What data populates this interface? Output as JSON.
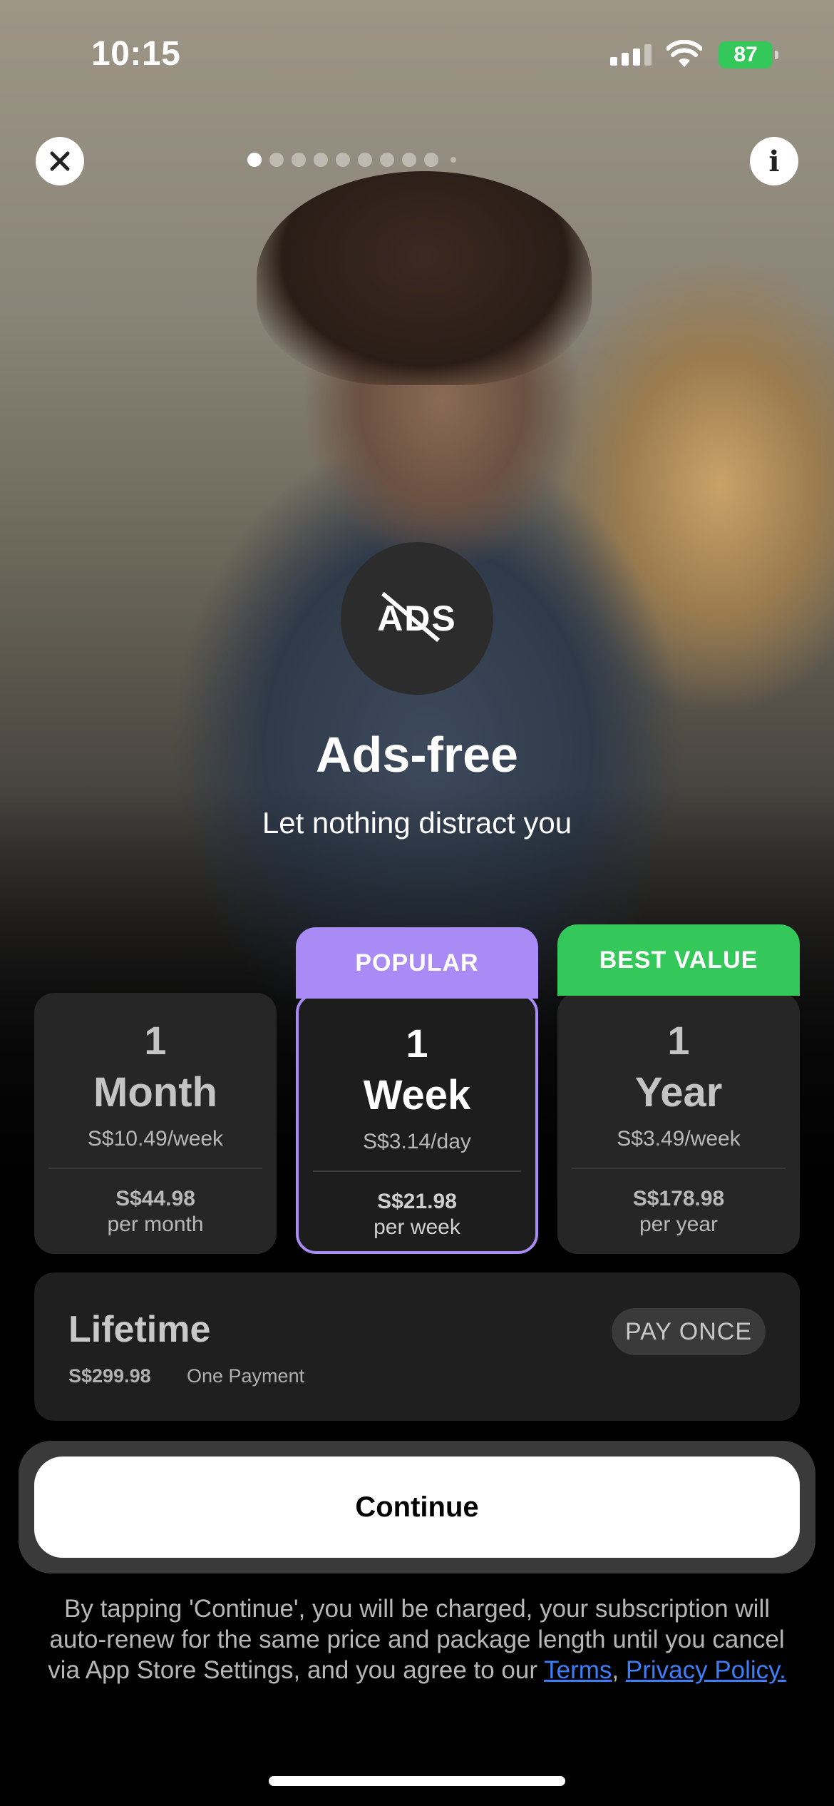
{
  "status_bar": {
    "time": "10:15",
    "battery": "87"
  },
  "pager": {
    "total": 10,
    "active": 0
  },
  "feature": {
    "icon_label": "ADS",
    "title": "Ads-free",
    "subtitle": "Let nothing distract you"
  },
  "plans": [
    {
      "num": "1",
      "unit": "Month",
      "rate": "S$10.49/week",
      "price": "S$44.98",
      "per": "per month"
    },
    {
      "tag": "POPULAR",
      "num": "1",
      "unit": "Week",
      "rate": "S$3.14/day",
      "price": "S$21.98",
      "per": "per week",
      "selected": true
    },
    {
      "tag": "BEST VALUE",
      "num": "1",
      "unit": "Year",
      "rate": "S$3.49/week",
      "price": "S$178.98",
      "per": "per year"
    }
  ],
  "lifetime": {
    "title": "Lifetime",
    "price": "S$299.98",
    "note": "One Payment",
    "pill": "PAY ONCE"
  },
  "continue_label": "Continue",
  "legal": {
    "text": "By tapping 'Continue', you will be charged, your subscription will auto-renew for the same price and package length until you cancel via App Store Settings, and you agree to our",
    "terms": "Terms",
    "sep": ",",
    "privacy": "Privacy Policy."
  },
  "colors": {
    "popular_tag": "#a98bf5",
    "best_value_tag": "#34c759",
    "link": "#3d7ef7"
  }
}
